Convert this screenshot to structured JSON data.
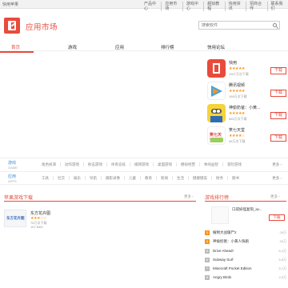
{
  "topbar": {
    "home": "快用苹果",
    "links": [
      "产品中心",
      "应用市场",
      "游戏中心",
      "越狱教程",
      "快用资讯",
      "招商合作",
      "联系我们"
    ]
  },
  "header": {
    "site_title": "应用市场",
    "search_placeholder": "搜索软件"
  },
  "nav": {
    "items": [
      "首页",
      "游戏",
      "应用",
      "排行榜",
      "快用论坛"
    ],
    "active": "首页"
  },
  "featured": [
    {
      "name": "快用",
      "stars": "★★★★★",
      "count": "1907万次下载",
      "download": "下载"
    },
    {
      "name": "腾讯视频",
      "stars": "★★★★★",
      "count": "168万次下载",
      "download": "下载"
    },
    {
      "name": "神偷奶爸：小黄...",
      "stars": "★★★★★",
      "count": "565万次下载",
      "download": "下载"
    },
    {
      "name": "笑七天堂",
      "stars": "★★★★☆",
      "count": "38万次下载",
      "download": "下载"
    }
  ],
  "categories": [
    {
      "label": "游戏",
      "sub": "GAME",
      "items": [
        "角色扮演",
        "动作游戏",
        "射击游戏",
        "体育竞技",
        "棋牌游戏",
        "桌面游戏",
        "模拟经营",
        "休闲益智",
        "冒险游戏"
      ],
      "more": "更多 ›"
    },
    {
      "label": "应用",
      "sub": "APPS",
      "items": [
        "工具",
        "社交",
        "娱乐",
        "导航",
        "摄影录像",
        "儿童",
        "教育",
        "新闻",
        "生活",
        "健康健美",
        "财务",
        "图书"
      ],
      "more": "更多 ›"
    }
  ],
  "apple_games": {
    "title": "苹果游戏下载",
    "more": "更多 ›",
    "game": {
      "icon_text": "东方花卉图",
      "name": "东方花卉图",
      "stars": "★★★☆☆",
      "count": "78万次下载",
      "size": "167.84M"
    }
  },
  "rank": {
    "title": "游戏排行榜",
    "more": "更多 ›",
    "top": {
      "name": "口袋妖怪复刻_iw...",
      "download": "下载"
    },
    "rows": [
      {
        "num": "3",
        "name": "植物大战僵尸2",
        "count": "28万"
      },
      {
        "num": "4",
        "name": "神偷奶爸：小黄人快跑",
        "count": "26万"
      },
      {
        "num": "5",
        "name": "Drive Ahead!",
        "count": "6.4万"
      },
      {
        "num": "6",
        "name": "Subway Surf",
        "count": "5.8万"
      },
      {
        "num": "7",
        "name": "Minecraft Pocket Edition",
        "count": "5.1万"
      },
      {
        "num": "8",
        "name": "Angry Birds",
        "count": "4.9万"
      }
    ]
  },
  "colors": {
    "accent": "#e84b3c",
    "link": "#3f8fe0",
    "star": "#f7941d"
  }
}
